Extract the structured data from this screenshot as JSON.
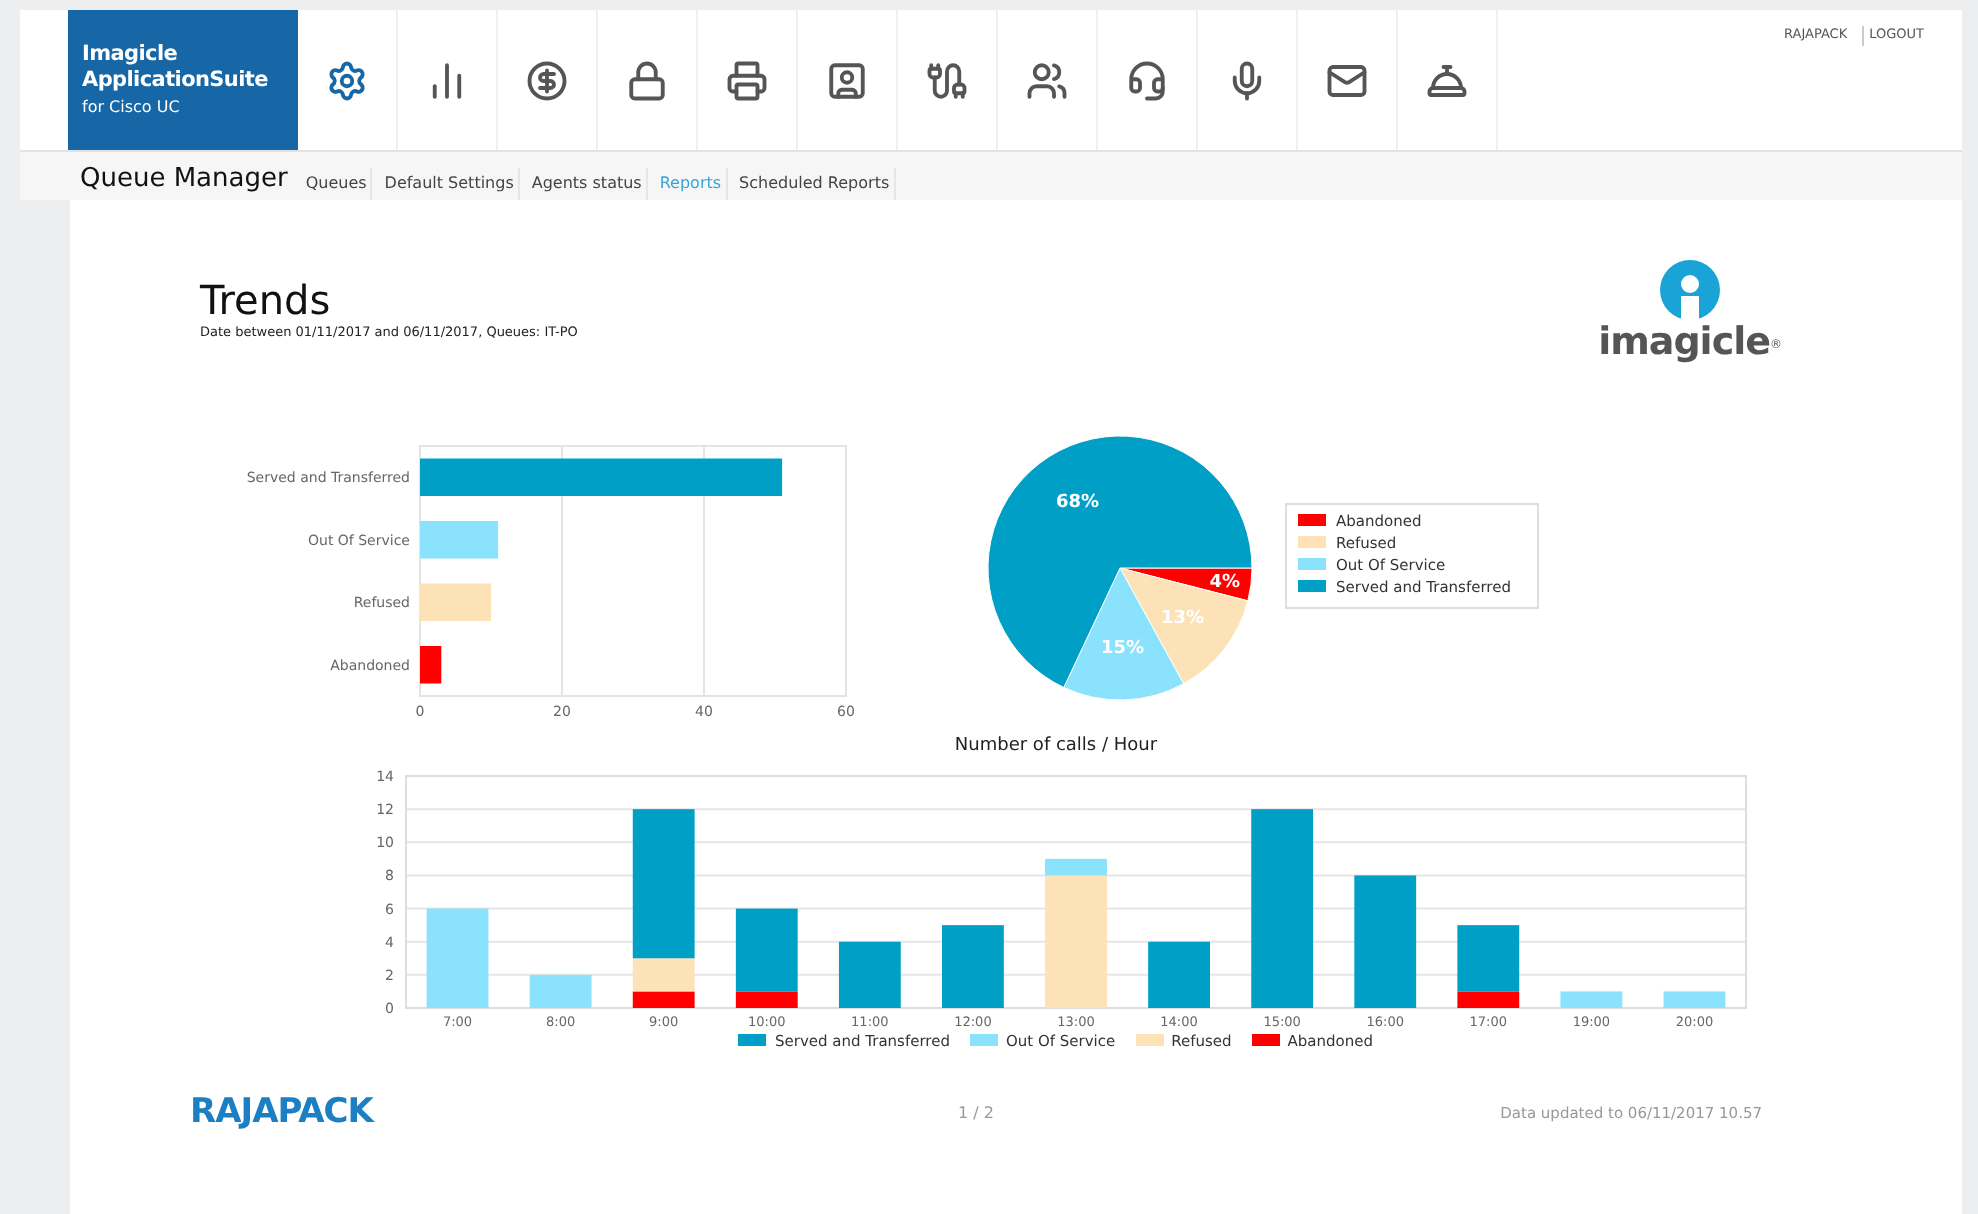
{
  "header": {
    "logo_lines": [
      "Imagicle",
      "ApplicationSuite"
    ],
    "logo_subtitle": "for Cisco UC",
    "user_links": [
      "RAJAPACK",
      "LOGOUT"
    ]
  },
  "nav": {
    "title": "Queue Manager",
    "tabs": [
      {
        "label": "Queues",
        "selected": false
      },
      {
        "label": "Default Settings",
        "selected": false
      },
      {
        "label": "Agents status",
        "selected": false
      },
      {
        "label": "Reports",
        "selected": true
      },
      {
        "label": "Scheduled Reports",
        "selected": false
      }
    ]
  },
  "report": {
    "title": "Trends",
    "subtitle": "Date between 01/11/2017 and 06/11/2017, Queues: IT-PO",
    "brand": "imagicle",
    "brand_mark": "®",
    "bar_chart": {
      "chart_data": {
        "type": "bar",
        "orientation": "horizontal",
        "categories": [
          "Served and Transferred",
          "Out Of Service",
          "Refused",
          "Abandoned"
        ],
        "values": [
          51,
          11,
          10,
          3
        ],
        "colors": [
          "#00a0c6",
          "#8ae2fc",
          "#fde2b8",
          "#ff0000"
        ],
        "xlim": [
          0,
          60
        ],
        "xticks": [
          0,
          20,
          40,
          60
        ],
        "grid": true
      }
    },
    "pie_chart": {
      "chart_data": {
        "type": "pie",
        "categories": [
          "Abandoned",
          "Refused",
          "Out Of Service",
          "Served and Transferred"
        ],
        "values": [
          4,
          13,
          15,
          68
        ],
        "colors": [
          "#ff0000",
          "#fde2b8",
          "#8ae2fc",
          "#00a0c6"
        ],
        "value_labels": [
          "4%",
          "13%",
          "15%",
          "68%"
        ],
        "legend": "right"
      }
    },
    "hour_chart": {
      "chart_data": {
        "type": "bar",
        "stacked": true,
        "grid": true,
        "legend": "bottom",
        "title": "Number of calls / Hour",
        "categories": [
          "7:00",
          "8:00",
          "9:00",
          "10:00",
          "11:00",
          "12:00",
          "13:00",
          "14:00",
          "15:00",
          "16:00",
          "17:00",
          "19:00",
          "20:00"
        ],
        "ylim": [
          0,
          14
        ],
        "yticks": [
          0,
          2,
          4,
          6,
          8,
          10,
          12,
          14
        ],
        "series": [
          {
            "name": "Served and Transferred",
            "color": "#00a0c6",
            "values": [
              0,
              0,
              9,
              5,
              4,
              5,
              0,
              4,
              12,
              8,
              4,
              0,
              0
            ]
          },
          {
            "name": "Out Of Service",
            "color": "#8ae2fc",
            "values": [
              6,
              2,
              0,
              0,
              0,
              0,
              1,
              0,
              0,
              0,
              0,
              1,
              1
            ]
          },
          {
            "name": "Refused",
            "color": "#fde2b8",
            "values": [
              0,
              0,
              2,
              0,
              0,
              0,
              8,
              0,
              0,
              0,
              0,
              0,
              0
            ]
          },
          {
            "name": "Abandoned",
            "color": "#ff0000",
            "values": [
              0,
              0,
              1,
              1,
              0,
              0,
              0,
              0,
              0,
              0,
              1,
              0,
              0
            ]
          }
        ]
      }
    },
    "footer": {
      "logo": "RAJAPACK",
      "page": "1 / 2",
      "updated": "Data updated to 06/11/2017 10.57"
    }
  }
}
